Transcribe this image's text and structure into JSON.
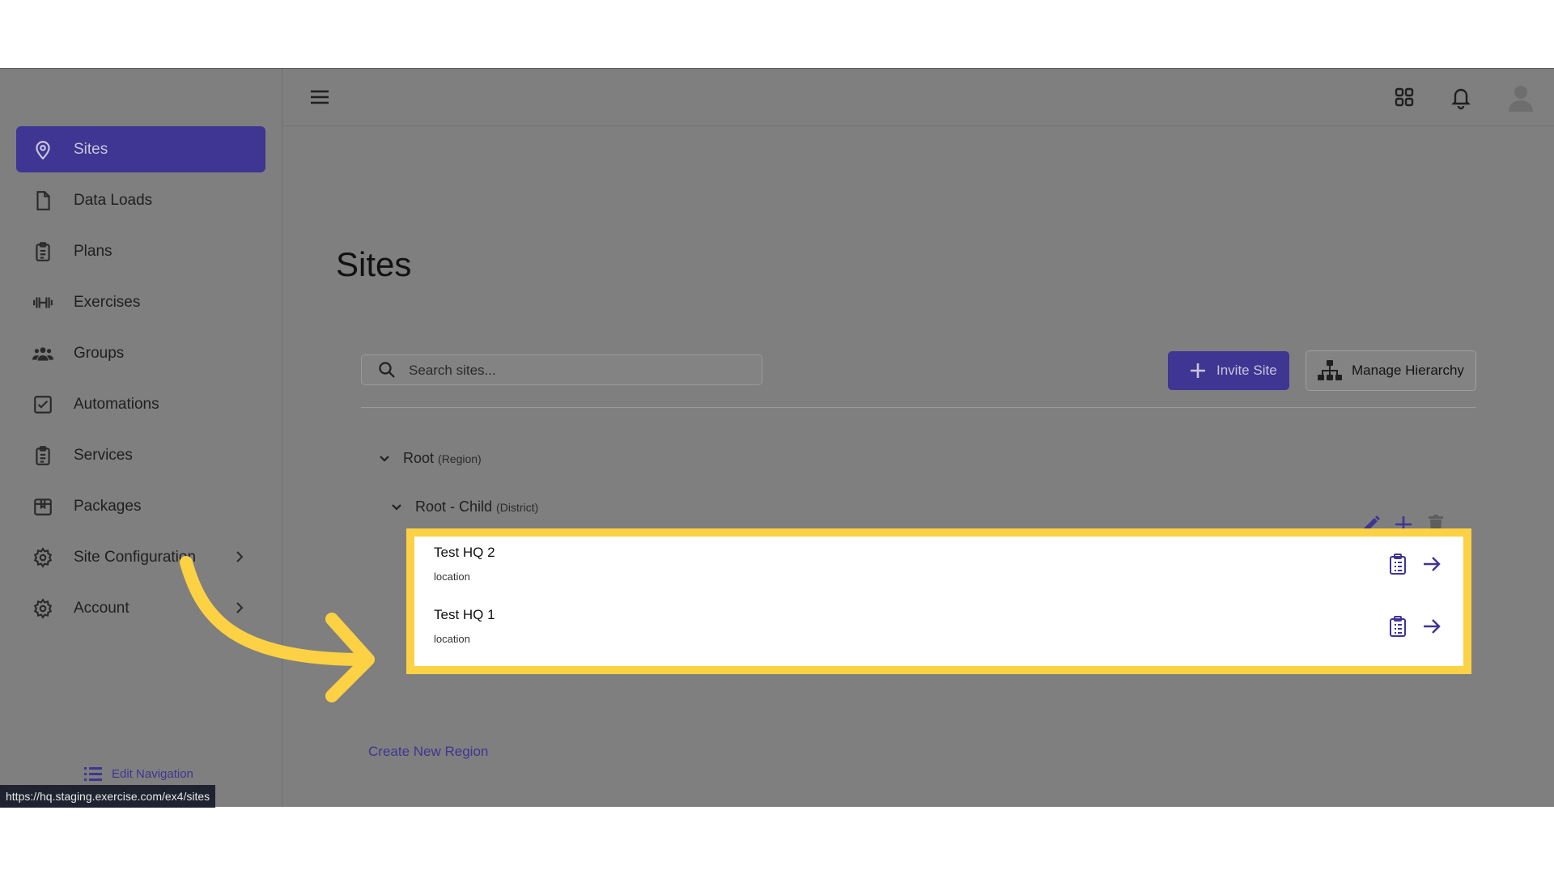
{
  "sidebar": {
    "items": [
      {
        "label": "Sites",
        "icon": "map-pin-icon",
        "active": true
      },
      {
        "label": "Data Loads",
        "icon": "file-icon"
      },
      {
        "label": "Plans",
        "icon": "clipboard-icon"
      },
      {
        "label": "Exercises",
        "icon": "dumbbell-icon"
      },
      {
        "label": "Groups",
        "icon": "users-icon"
      },
      {
        "label": "Automations",
        "icon": "checkbox-icon"
      },
      {
        "label": "Services",
        "icon": "clipboard-list-icon"
      },
      {
        "label": "Packages",
        "icon": "package-icon"
      },
      {
        "label": "Site Configuration",
        "icon": "gear-icon"
      },
      {
        "label": "Account",
        "icon": "gear-icon"
      }
    ],
    "edit_navigation_label": "Edit Navigation"
  },
  "status_bar": {
    "url": "https://hq.staging.exercise.com/ex4/sites"
  },
  "page": {
    "title": "Sites"
  },
  "toolbar": {
    "search_placeholder": "Search sites...",
    "invite_label": "Invite Site",
    "manage_label": "Manage Hierarchy"
  },
  "tree": {
    "root": {
      "name": "Root",
      "type": "(Region)"
    },
    "child": {
      "name": "Root - Child",
      "type": "(District)"
    },
    "sites": [
      {
        "name": "Test HQ 2",
        "type": "location"
      },
      {
        "name": "Test HQ 1",
        "type": "location"
      }
    ],
    "create_region_label": "Create New Region"
  },
  "colors": {
    "accent": "#3f3592",
    "highlight": "#fcd144",
    "overlay": "#7f7f7f"
  }
}
